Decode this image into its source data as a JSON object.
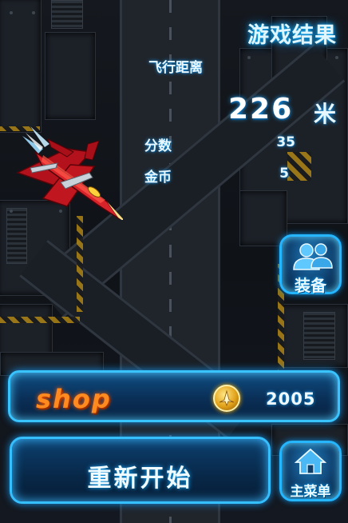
{
  "results": {
    "title": "游戏结果",
    "distance_label": "飞行距离",
    "distance_value": "226",
    "distance_unit": "米",
    "score_label": "分数",
    "score_value": "35",
    "gold_label": "金币",
    "gold_value": "5"
  },
  "buttons": {
    "equipment_label": "装备",
    "main_menu_label": "主菜单",
    "restart_label": "重新开始"
  },
  "shop": {
    "label": "shop",
    "coin_total": "2005"
  },
  "colors": {
    "accent_blue": "#25b6ff",
    "shop_orange": "#ff8a1f",
    "coin_gold": "#e2a21a"
  },
  "icons": {
    "equipment": "people-icon",
    "main_menu": "home-icon",
    "coin": "coin-jet-icon",
    "player": "red-fighter-jet"
  }
}
